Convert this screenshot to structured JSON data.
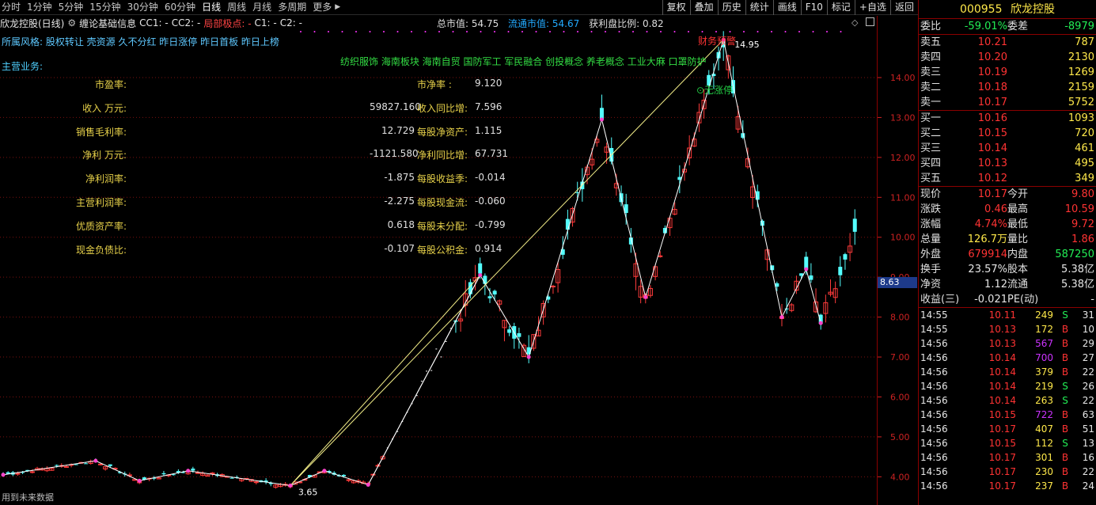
{
  "period_tabs": [
    "分时",
    "1分钟",
    "5分钟",
    "15分钟",
    "30分钟",
    "60分钟",
    "日线",
    "周线",
    "月线",
    "多周期",
    "更多"
  ],
  "active_period": "日线",
  "more_arrow": "▶",
  "toolbar": [
    "复权",
    "叠加",
    "历史",
    "统计",
    "画线",
    "F10",
    "标记",
    "+自选",
    "返回"
  ],
  "legend": {
    "title": "欣龙控股(日线)",
    "indicator": "缠论基础信息",
    "cc1": "CC1: -",
    "cc2": "CC2: -",
    "local": "局部极点: -",
    "c1": "C1: -",
    "c2": "C2: -"
  },
  "market": {
    "total_label": "总市值: ",
    "total_value": "54.75",
    "float_label": "流通市值: ",
    "float_value": "54.67",
    "profit_label": "获利盘比例: ",
    "profit_value": "0.82"
  },
  "style_line": "所属风格: 股权转让 壳资源 久不分红 昨日涨停 昨日首板 昨日上榜",
  "biz_line": "主营业务:",
  "concepts": "纺织服饰 海南板块 海南自贸 国防军工 军民融合 创投概念 养老概念 工业大麻 口罩防护",
  "finance": [
    {
      "k1": "市盈率:",
      "v1": "",
      "k2": "市净率 :",
      "v2": "9.120"
    },
    {
      "k1": "收入 万元:",
      "v1": "59827.160",
      "k2": "收入同比增:",
      "v2": "7.596"
    },
    {
      "k1": "销售毛利率:",
      "v1": "12.729",
      "k2": "每股净资产:",
      "v2": "1.115"
    },
    {
      "k1": "净利 万元:",
      "v1": "-1121.580",
      "k2": "净利同比增:",
      "v2": "67.731"
    },
    {
      "k1": "净利润率:",
      "v1": "-1.875",
      "k2": "每股收益季:",
      "v2": "-0.014"
    },
    {
      "k1": "主营利润率:",
      "v1": "-2.275",
      "k2": "每股现金流:",
      "v2": "-0.060"
    },
    {
      "k1": "优质资产率:",
      "v1": "0.618",
      "k2": "每股未分配:",
      "v2": "-0.799"
    },
    {
      "k1": "现金负债比:",
      "v1": "-0.107",
      "k2": "每股公积金:",
      "v2": "0.914"
    }
  ],
  "chart_labels": {
    "high": "14.95",
    "low": "3.65",
    "warn": "财务预警",
    "extra": "⊙无涨停"
  },
  "footer_note": "用到未来数据",
  "chart_data": {
    "type": "candlestick",
    "ylim": [
      3.65,
      15.15
    ],
    "yticks": [
      4.0,
      5.0,
      6.0,
      7.0,
      8.0,
      9.0,
      10.0,
      11.0,
      12.0,
      13.0,
      14.0
    ],
    "current_price_tag": "8.63",
    "high_label": "14.95",
    "low_label": "3.65",
    "zigzag_points": [
      {
        "i": 0,
        "y": 4.05
      },
      {
        "i": 19,
        "y": 4.4
      },
      {
        "i": 28,
        "y": 3.9
      },
      {
        "i": 38,
        "y": 4.15
      },
      {
        "i": 59,
        "y": 3.78
      },
      {
        "i": 66,
        "y": 4.15
      },
      {
        "i": 75,
        "y": 3.8
      },
      {
        "i": 98,
        "y": 9.05
      },
      {
        "i": 108,
        "y": 7.0
      },
      {
        "i": 123,
        "y": 12.95
      },
      {
        "i": 132,
        "y": 8.5
      },
      {
        "i": 148,
        "y": 14.95
      },
      {
        "i": 160,
        "y": 8.0
      },
      {
        "i": 165,
        "y": 9.2
      },
      {
        "i": 168,
        "y": 7.85
      }
    ]
  },
  "quote": {
    "code": "000955",
    "name": "欣龙控股",
    "wb_label": "委比",
    "wb_value": "-59.01%",
    "wc_label": "委差",
    "wc_value": "-8979",
    "asks": [
      {
        "label": "卖五",
        "price": "10.21",
        "vol": "787"
      },
      {
        "label": "卖四",
        "price": "10.20",
        "vol": "2130"
      },
      {
        "label": "卖三",
        "price": "10.19",
        "vol": "1269"
      },
      {
        "label": "卖二",
        "price": "10.18",
        "vol": "2159"
      },
      {
        "label": "卖一",
        "price": "10.17",
        "vol": "5752"
      }
    ],
    "bids": [
      {
        "label": "买一",
        "price": "10.16",
        "vol": "1093"
      },
      {
        "label": "买二",
        "price": "10.15",
        "vol": "720"
      },
      {
        "label": "买三",
        "price": "10.14",
        "vol": "461"
      },
      {
        "label": "买四",
        "price": "10.13",
        "vol": "495"
      },
      {
        "label": "买五",
        "price": "10.12",
        "vol": "349"
      }
    ],
    "stats": [
      {
        "a": "现价",
        "b": "10.17",
        "bc": "red",
        "c": "今开",
        "d": "9.80",
        "dc": "red"
      },
      {
        "a": "涨跌",
        "b": "0.46",
        "bc": "red",
        "c": "最高",
        "d": "10.59",
        "dc": "red"
      },
      {
        "a": "涨幅",
        "b": "4.74%",
        "bc": "red",
        "c": "最低",
        "d": "9.72",
        "dc": "red"
      },
      {
        "a": "总量",
        "b": "126.7万",
        "bc": "yellow",
        "c": "量比",
        "d": "1.86",
        "dc": "red"
      },
      {
        "a": "外盘",
        "b": "679914",
        "bc": "red",
        "c": "内盘",
        "d": "587250",
        "dc": "green"
      },
      {
        "a": "换手",
        "b": "23.57%",
        "bc": "white",
        "c": "股本",
        "d": "5.38亿",
        "dc": "white"
      },
      {
        "a": "净资",
        "b": "1.12",
        "bc": "white",
        "c": "流通",
        "d": "5.38亿",
        "dc": "white"
      },
      {
        "a": "收益(三)",
        "b": "-0.021",
        "bc": "white",
        "c": "PE(动)",
        "d": "-",
        "dc": "white"
      }
    ],
    "ticks": [
      {
        "t": "14:55",
        "p": "10.11",
        "v": "249",
        "s": "S",
        "n": "31"
      },
      {
        "t": "14:55",
        "p": "10.13",
        "v": "172",
        "s": "B",
        "n": "10"
      },
      {
        "t": "14:56",
        "p": "10.13",
        "v": "567",
        "s": "B",
        "n": "29"
      },
      {
        "t": "14:56",
        "p": "10.14",
        "v": "700",
        "s": "B",
        "n": "27"
      },
      {
        "t": "14:56",
        "p": "10.14",
        "v": "379",
        "s": "B",
        "n": "22"
      },
      {
        "t": "14:56",
        "p": "10.14",
        "v": "219",
        "s": "S",
        "n": "26"
      },
      {
        "t": "14:56",
        "p": "10.14",
        "v": "263",
        "s": "S",
        "n": "22"
      },
      {
        "t": "14:56",
        "p": "10.15",
        "v": "722",
        "s": "B",
        "n": "63"
      },
      {
        "t": "14:56",
        "p": "10.17",
        "v": "407",
        "s": "B",
        "n": "51"
      },
      {
        "t": "14:56",
        "p": "10.15",
        "v": "112",
        "s": "S",
        "n": "13"
      },
      {
        "t": "14:56",
        "p": "10.17",
        "v": "301",
        "s": "B",
        "n": "16"
      },
      {
        "t": "14:56",
        "p": "10.17",
        "v": "230",
        "s": "B",
        "n": "22"
      },
      {
        "t": "14:56",
        "p": "10.17",
        "v": "237",
        "s": "B",
        "n": "24"
      }
    ]
  }
}
